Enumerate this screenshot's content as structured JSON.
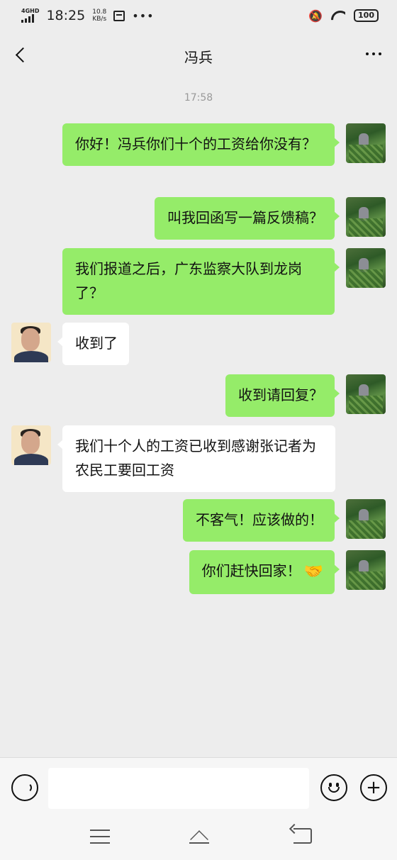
{
  "status_bar": {
    "network": "4GHD",
    "time": "18:25",
    "speed_value": "10.8",
    "speed_unit": "KB/s",
    "battery": "100"
  },
  "header": {
    "title": "冯兵"
  },
  "chat": {
    "timestamp": "17:58",
    "messages": [
      {
        "sender": "me",
        "text": "你好！冯兵你们十个的工资给你没有？"
      },
      {
        "sender": "me",
        "text": "叫我回函写一篇反馈稿？"
      },
      {
        "sender": "me",
        "text": "我们报道之后，广东监察大队到龙岗了？"
      },
      {
        "sender": "them",
        "text": "收到了"
      },
      {
        "sender": "me",
        "text": "收到请回复？"
      },
      {
        "sender": "them",
        "text": "我们十个人的工资已收到感谢张记者为农民工要回工资"
      },
      {
        "sender": "me",
        "text": "不客气！应该做的！"
      },
      {
        "sender": "me",
        "text": "你们赶快回家！",
        "emoji": "handshake-icon"
      }
    ]
  },
  "colors": {
    "outgoing_bubble": "#95ec69",
    "incoming_bubble": "#ffffff",
    "background": "#ededed"
  },
  "handshake": "🤝"
}
